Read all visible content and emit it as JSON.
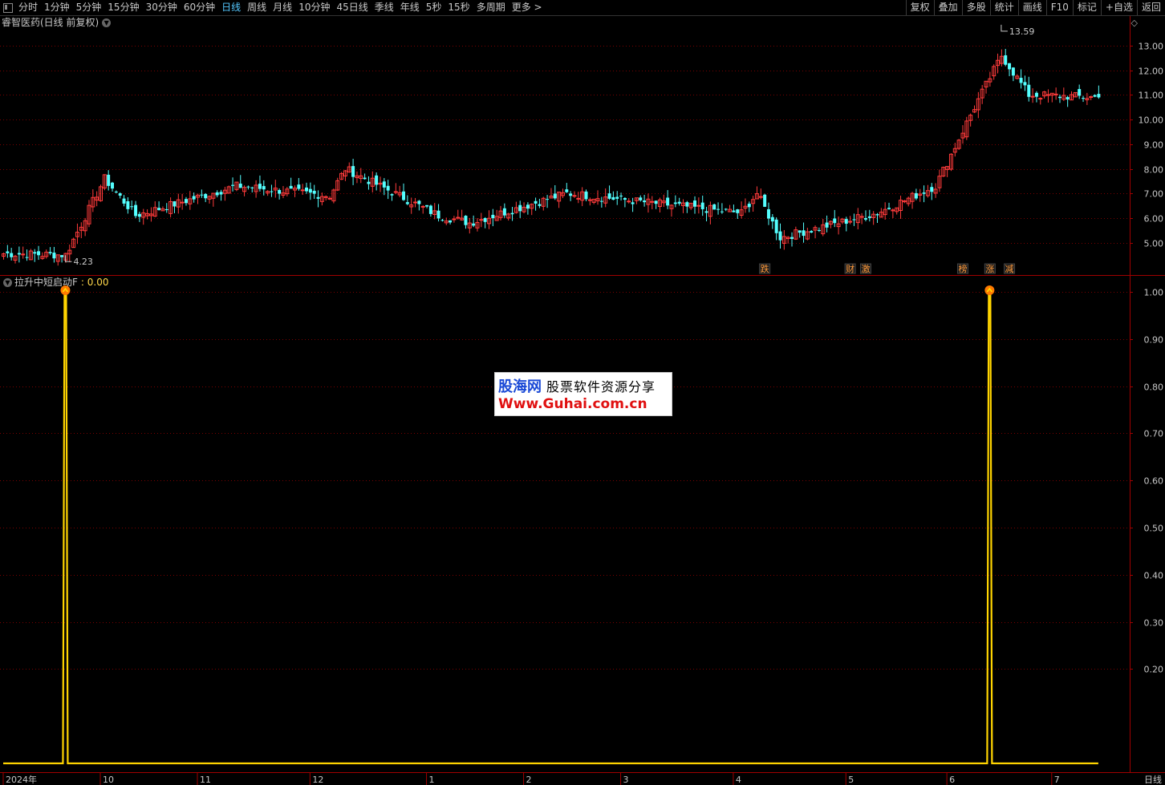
{
  "toolbar": {
    "periods": [
      "分时",
      "1分钟",
      "5分钟",
      "15分钟",
      "30分钟",
      "60分钟",
      "日线",
      "周线",
      "月线",
      "10分钟",
      "45日线",
      "季线",
      "年线",
      "5秒",
      "15秒",
      "多周期",
      "更多 >"
    ],
    "active": "日线",
    "buttons": [
      "复权",
      "叠加",
      "多股",
      "统计",
      "画线",
      "F10",
      "标记",
      "+自选",
      "返回"
    ]
  },
  "main_title": "睿智医药(日线 前复权)",
  "indicator": {
    "name": "拉升中短启动F",
    "value": ": 0.00"
  },
  "watermark": {
    "logo": "股海网",
    "sub": "股票软件资源分享",
    "url": "Www.Guhai.com.cn"
  },
  "colors": {
    "up": "#ff3b3b",
    "down": "#54ffff",
    "grid": "#7a0000",
    "axis": "#a00000",
    "signal": "#ffd400"
  },
  "bottom_right_label": "日线",
  "chart_data": [
    {
      "type": "candlestick",
      "title": "睿智医药(日线 前复权)",
      "ylim": [
        4.0,
        13.8
      ],
      "y_ticks": [
        "13.00",
        "12.00",
        "11.00",
        "10.00",
        "9.00",
        "8.00",
        "7.00",
        "6.00",
        "5.00"
      ],
      "annotations": [
        {
          "label": "4.23",
          "index": 16
        },
        {
          "label": "13.59",
          "index": 257
        }
      ],
      "event_labels": [
        {
          "label": "跌",
          "index": 196
        },
        {
          "label": "财",
          "index": 218
        },
        {
          "label": "激",
          "index": 222
        },
        {
          "label": "榜",
          "index": 247
        },
        {
          "label": "涨",
          "index": 254
        },
        {
          "label": "减",
          "index": 259
        }
      ],
      "key_points": [
        {
          "index": 0,
          "close": 4.55
        },
        {
          "index": 16,
          "close": 4.5
        },
        {
          "index": 26,
          "close": 7.6
        },
        {
          "index": 34,
          "close": 6.1
        },
        {
          "index": 60,
          "close": 7.3
        },
        {
          "index": 84,
          "close": 6.9
        },
        {
          "index": 88,
          "close": 8.0
        },
        {
          "index": 112,
          "close": 6.1
        },
        {
          "index": 120,
          "close": 5.8
        },
        {
          "index": 145,
          "close": 7.0
        },
        {
          "index": 190,
          "close": 6.2
        },
        {
          "index": 194,
          "close": 7.0
        },
        {
          "index": 200,
          "close": 5.2
        },
        {
          "index": 225,
          "close": 6.2
        },
        {
          "index": 240,
          "close": 7.3
        },
        {
          "index": 250,
          "close": 10.5
        },
        {
          "index": 257,
          "close": 12.6
        },
        {
          "index": 264,
          "close": 11.0
        },
        {
          "index": 282,
          "close": 10.9
        }
      ]
    },
    {
      "type": "line",
      "title": "拉升中短启动F",
      "ylim": [
        0,
        1.05
      ],
      "y_ticks": [
        "1.00",
        "0.90",
        "0.80",
        "0.70",
        "0.60",
        "0.50",
        "0.40",
        "0.30",
        "0.20"
      ],
      "signal_indices": [
        16,
        254
      ],
      "signal_value": 1.0,
      "baseline": 0.0
    }
  ],
  "x_axis": {
    "labels": [
      {
        "label": "2024年",
        "index": 0
      },
      {
        "label": "10",
        "index": 25
      },
      {
        "label": "11",
        "index": 50
      },
      {
        "label": "12",
        "index": 79
      },
      {
        "label": "1",
        "index": 109
      },
      {
        "label": "2",
        "index": 134
      },
      {
        "label": "3",
        "index": 159
      },
      {
        "label": "4",
        "index": 188
      },
      {
        "label": "5",
        "index": 217
      },
      {
        "label": "6",
        "index": 243
      },
      {
        "label": "7",
        "index": 270
      }
    ],
    "count": 283
  }
}
